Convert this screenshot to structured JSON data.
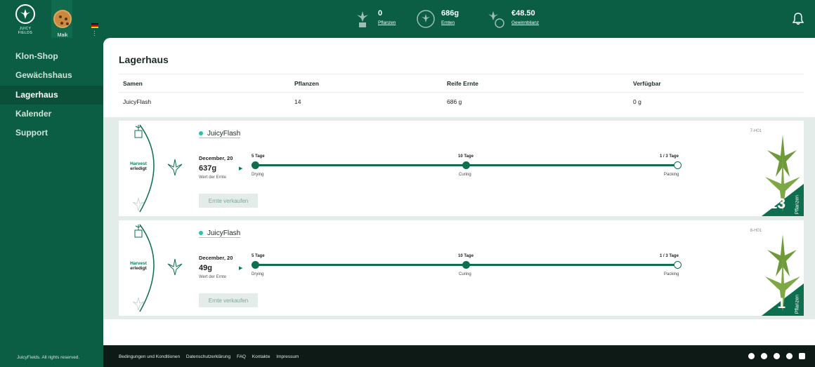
{
  "brand": {
    "name": "JUICY FIELDS"
  },
  "user": {
    "name": "Maik"
  },
  "header": {
    "stats": [
      {
        "value": "0",
        "label": "Pflanzen",
        "icon": "plant-pot-icon"
      },
      {
        "value": "686g",
        "label": "Ernten",
        "icon": "harvest-wreath-icon"
      },
      {
        "value": "€48.50",
        "label": "Gewinnbilanz",
        "icon": "money-plant-icon"
      }
    ]
  },
  "sidebar": {
    "items": [
      {
        "label": "Klon-Shop",
        "active": false
      },
      {
        "label": "Gewächshaus",
        "active": false
      },
      {
        "label": "Lagerhaus",
        "active": true
      },
      {
        "label": "Kalender",
        "active": false
      },
      {
        "label": "Support",
        "active": false
      }
    ],
    "copyright": "JuicyFields. All rights reserved."
  },
  "main": {
    "title": "Lagerhaus",
    "table": {
      "headers": [
        "Samen",
        "Pflanzen",
        "Reife Ernte",
        "Verfügbar"
      ],
      "rows": [
        [
          "JuicyFlash",
          "14",
          "686 g",
          "0 g"
        ]
      ]
    },
    "cards": [
      {
        "harvest_line1": "Harvest",
        "harvest_line2": "erledigt",
        "strain": "JuicyFlash",
        "date": "December, 20",
        "weight": "637g",
        "weight_label": "Wert der Ernte",
        "steps": [
          {
            "top": "5 Tage",
            "bottom": "Drying",
            "done": true
          },
          {
            "top": "10 Tage",
            "bottom": "Curing",
            "done": true
          },
          {
            "top": "1 / 3 Tage",
            "bottom": "Packing",
            "done": false
          }
        ],
        "sell_label": "Ernte verkaufen",
        "code": "7-H01",
        "count": "13",
        "count_label": "Pflanzen"
      },
      {
        "harvest_line1": "Harvest",
        "harvest_line2": "erledigt",
        "strain": "JuicyFlash",
        "date": "December, 20",
        "weight": "49g",
        "weight_label": "Wert der Ernte",
        "steps": [
          {
            "top": "5 Tage",
            "bottom": "Drying",
            "done": true
          },
          {
            "top": "10 Tage",
            "bottom": "Curing",
            "done": true
          },
          {
            "top": "1 / 3 Tage",
            "bottom": "Packing",
            "done": false
          }
        ],
        "sell_label": "Ernte verkaufen",
        "code": "8-H01",
        "count": "1",
        "count_label": "Pflanzen"
      }
    ]
  },
  "footer": {
    "links": [
      "Bedingungen und Konditionen",
      "Datenschutzerklärung",
      "FAQ",
      "Kontakte",
      "Impressum"
    ],
    "social": [
      "telegram-icon",
      "facebook-icon",
      "instagram-icon",
      "linkedin-icon",
      "youtube-icon"
    ]
  },
  "colors": {
    "brand_green": "#0b5e43",
    "accent": "#1fc9a8",
    "footer": "#0d1a15"
  }
}
